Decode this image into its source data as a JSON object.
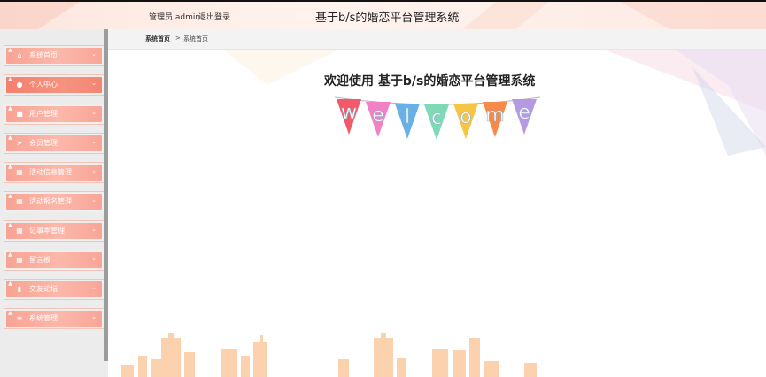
{
  "header": {
    "user_label": "管理员 admin",
    "logout_label": "退出登录",
    "title": "基于b/s的婚恋平台管理系统"
  },
  "sidebar": {
    "items": [
      {
        "label": "系统首页",
        "icon": "home-icon"
      },
      {
        "label": "个人中心",
        "icon": "user-icon",
        "active": true
      },
      {
        "label": "用户管理",
        "icon": "briefcase-icon"
      },
      {
        "label": "会员管理",
        "icon": "paper-plane-icon"
      },
      {
        "label": "活动信息管理",
        "icon": "grid-icon"
      },
      {
        "label": "活动报名管理",
        "icon": "grid-icon"
      },
      {
        "label": "记事本管理",
        "icon": "grid-icon"
      },
      {
        "label": "留言板",
        "icon": "grid-icon"
      },
      {
        "label": "交友论坛",
        "icon": "bar-chart-icon"
      },
      {
        "label": "系统管理",
        "icon": "list-icon"
      }
    ]
  },
  "breadcrumb": {
    "home": "系统首页",
    "separator": ">",
    "current": "系统首页"
  },
  "main": {
    "welcome_title": "欢迎使用 基于b/s的婚恋平台管理系统",
    "banner_letters": [
      "w",
      "e",
      "l",
      "c",
      "o",
      "m",
      "e"
    ]
  },
  "colors": {
    "accent": "#f48672",
    "nav_bg": "#f9a597",
    "skyline": "#fbc9a0"
  }
}
